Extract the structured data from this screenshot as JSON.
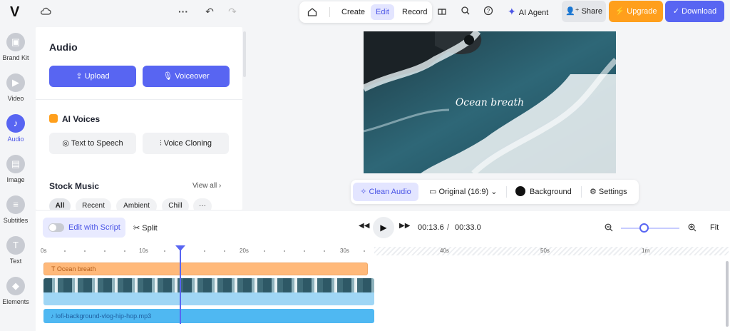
{
  "app": {
    "logo": "V"
  },
  "topbar": {
    "tabs": [
      {
        "label": "Create",
        "active": false
      },
      {
        "label": "Edit",
        "active": true
      },
      {
        "label": "Record",
        "active": false
      }
    ],
    "ai_agent": "AI Agent",
    "share": "Share",
    "upgrade": "Upgrade",
    "download": "Download"
  },
  "rail": [
    {
      "label": "Brand Kit",
      "icon": "brand-kit-icon",
      "active": false
    },
    {
      "label": "Video",
      "icon": "video-icon",
      "active": false
    },
    {
      "label": "Audio",
      "icon": "music-note-icon",
      "active": true
    },
    {
      "label": "Image",
      "icon": "image-icon",
      "active": false
    },
    {
      "label": "Subtitles",
      "icon": "subtitles-icon",
      "active": false
    },
    {
      "label": "Text",
      "icon": "text-icon",
      "active": false
    },
    {
      "label": "Elements",
      "icon": "elements-icon",
      "active": false
    }
  ],
  "panel": {
    "title": "Audio",
    "upload": "Upload",
    "voiceover": "Voiceover",
    "ai_voices": "AI Voices",
    "text_to_speech": "Text to Speech",
    "voice_cloning": "Voice Cloning",
    "stock_music": "Stock Music",
    "view_all": "View all",
    "chips": [
      "All",
      "Recent",
      "Ambient",
      "Chill",
      "···"
    ]
  },
  "preview": {
    "caption": "Ocean breath",
    "toolbar": {
      "clean_audio": "Clean Audio",
      "aspect": "Original (16:9)",
      "background": "Background",
      "settings": "Settings"
    }
  },
  "timeline": {
    "edit_with_script": "Edit with Script",
    "split": "Split",
    "current_time": "00:13.6",
    "separator": "/",
    "total_time": "00:33.0",
    "fit": "Fit",
    "zoom_level": 0.4,
    "ruler": [
      "0s",
      "10s",
      "20s",
      "30s",
      "40s",
      "50s",
      "1m"
    ],
    "tracks": {
      "text": "Ocean breath",
      "audio": "lofi-background-vlog-hip-hop.mp3"
    }
  },
  "colors": {
    "accent": "#5865f2",
    "upgrade": "#ff9f1c",
    "text_clip": "#ffb97a",
    "audio_clip": "#4fb8f2"
  }
}
